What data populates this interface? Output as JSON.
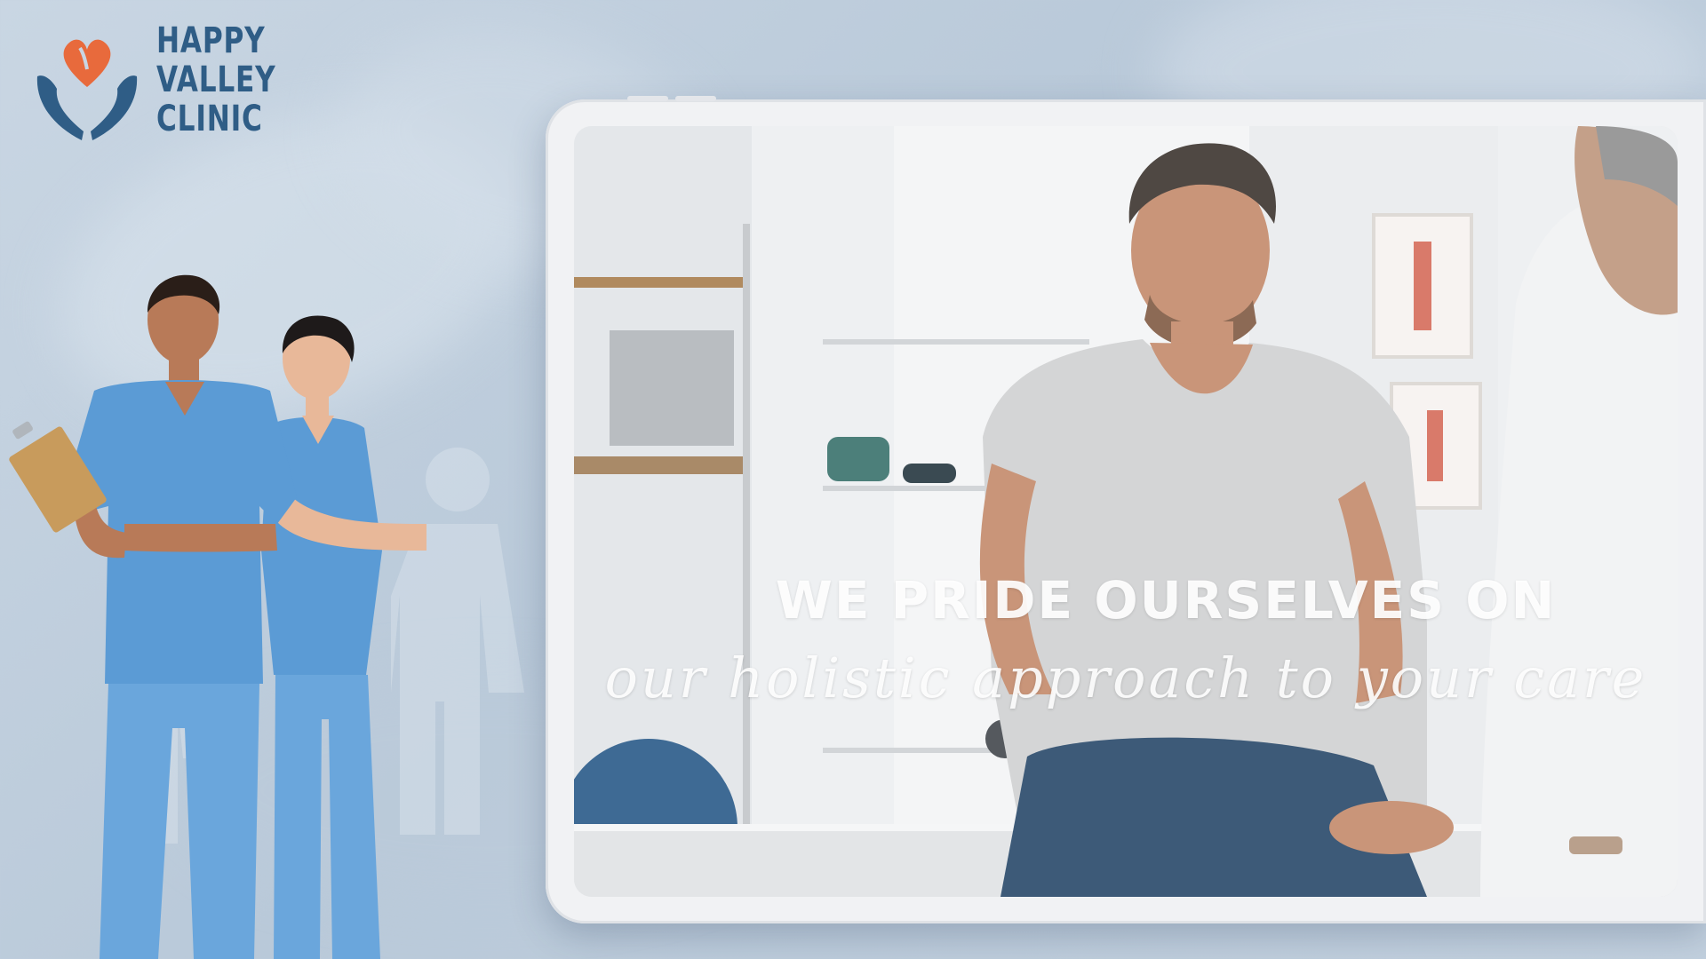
{
  "brand": {
    "logo_line1": "HAPPY",
    "logo_line2": "VALLEY",
    "logo_line3": "CLINIC",
    "colors": {
      "heart": "#e86a3c",
      "hands": "#2f5d86",
      "text": "#2f5d86"
    }
  },
  "hero": {
    "headline": "WE PRIDE OURSELVES ON",
    "tagline": "our holistic approach to your care"
  },
  "icons": {
    "logo": "heart-hands-logo-icon",
    "figure": "person-figure-icon"
  },
  "colors": {
    "background": "#c3d1df",
    "scrubs": "#5b9bd5",
    "tablet_frame": "#f1f2f4"
  }
}
